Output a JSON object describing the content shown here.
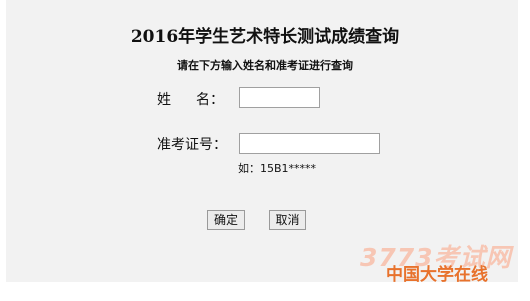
{
  "page": {
    "title": "2016年学生艺术特长测试成绩查询",
    "subtitle": "请在下方输入姓名和准考证进行查询"
  },
  "form": {
    "name_label_left": "姓",
    "name_label_right": "名：",
    "name_value": "",
    "exam_label": "准考证号：",
    "exam_value": "",
    "hint": "如：15B1*****"
  },
  "buttons": {
    "submit": "确定",
    "cancel": "取消"
  },
  "watermark": {
    "site": "3773考试网",
    "brand": "中国大学在线"
  }
}
